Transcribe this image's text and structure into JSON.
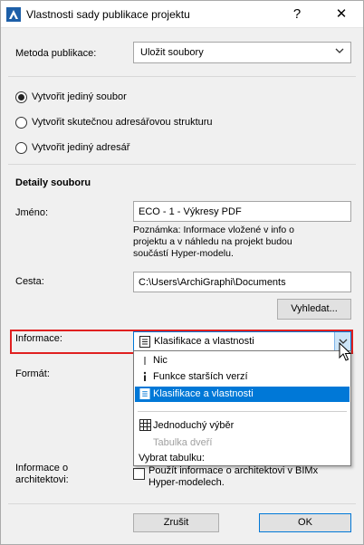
{
  "window": {
    "title": "Vlastnosti sady publikace projektu",
    "help_symbol": "?",
    "close_symbol": "✕"
  },
  "method": {
    "label": "Metoda publikace:",
    "value": "Uložit soubory"
  },
  "radios": [
    {
      "label": "Vytvořit jediný soubor",
      "checked": true
    },
    {
      "label": "Vytvořit skutečnou adresářovou strukturu",
      "checked": false
    },
    {
      "label": "Vytvořit jediný adresář",
      "checked": false
    }
  ],
  "details": {
    "heading": "Detaily souboru",
    "name_label": "Jméno:",
    "name_value": "ECO - 1 - Výkresy PDF",
    "note_line1": "Poznámka: Informace vložené v info o",
    "note_line2": "projektu a v náhledu na projekt budou",
    "note_line3": "součástí Hyper-modelu.",
    "path_label": "Cesta:",
    "path_value": "C:\\Users\\ArchiGraphi\\Documents",
    "browse_button": "Vyhledat..."
  },
  "info": {
    "label": "Informace:",
    "value": "Klasifikace a vlastnosti"
  },
  "format_label": "Formát:",
  "dropdown": {
    "items": [
      {
        "label": "Nic",
        "icon": "thin-i-icon"
      },
      {
        "label": "Funkce starších verzí",
        "icon": "info-i-icon"
      },
      {
        "label": "Klasifikace a vlastnosti",
        "icon": "list-doc-icon",
        "selected": true
      }
    ],
    "grid_item": "Jednoduchý výběr",
    "disabled_item": "Tabulka dveří",
    "group_label": "Vybrat tabulku:"
  },
  "architect": {
    "label_line1": "Informace o",
    "label_line2": "architektovi:",
    "checkbox_line1": "Použít informace o architektovi v BIMx",
    "checkbox_line2": "Hyper-modelech."
  },
  "buttons": {
    "cancel": "Zrušit",
    "ok": "OK"
  }
}
